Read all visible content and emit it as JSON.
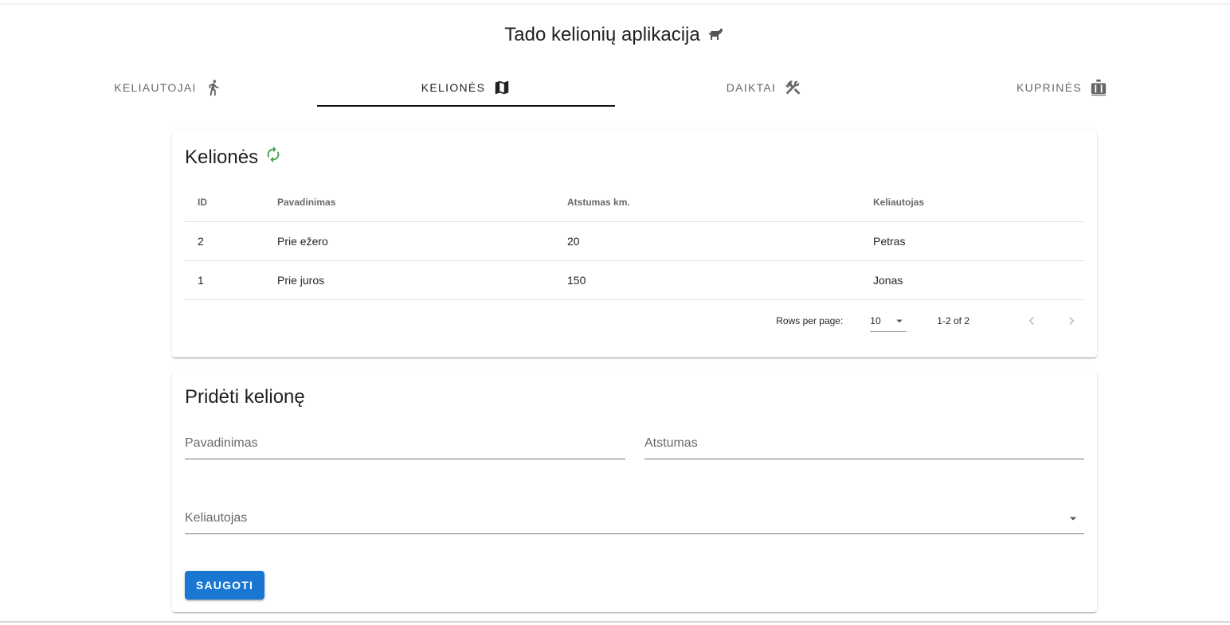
{
  "app": {
    "title": "Tado kelionių aplikacija",
    "icon": "dog-icon"
  },
  "tabs": [
    {
      "label": "KELIAUTOJAI",
      "icon": "walk-icon",
      "active": false
    },
    {
      "label": "KELIONĖS",
      "icon": "map-icon",
      "active": true
    },
    {
      "label": "DAIKTAI",
      "icon": "tools-icon",
      "active": false
    },
    {
      "label": "KUPRINĖS",
      "icon": "bag-icon",
      "active": false
    }
  ],
  "trips_card": {
    "title": "Kelionės",
    "refresh_icon": "refresh-icon",
    "refresh_color": "#43a047",
    "columns": [
      "ID",
      "Pavadinimas",
      "Atstumas km.",
      "Keliautojas"
    ],
    "rows": [
      [
        "2",
        "Prie ežero",
        "20",
        "Petras"
      ],
      [
        "1",
        "Prie juros",
        "150",
        "Jonas"
      ]
    ],
    "pagination": {
      "rows_per_page_label": "Rows per page:",
      "rows_per_page_value": "10",
      "range": "1-2 of 2"
    }
  },
  "add_card": {
    "title": "Pridėti kelionę",
    "name_field": "Pavadinimas",
    "distance_field": "Atstumas",
    "traveler_field": "Keliautojas",
    "save_label": "SAUGOTI",
    "button_color": "#1976d2"
  }
}
